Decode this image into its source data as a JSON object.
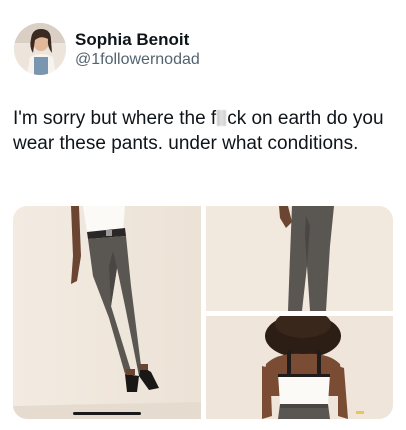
{
  "tweet": {
    "display_name": "Sophia Benoit",
    "handle": "@1followernodad",
    "text_part1": "I'm sorry but where the f",
    "text_part2": "ck on earth do you wear these pants. under what conditions."
  },
  "media": {
    "image_count": 3
  },
  "colors": {
    "text": "#0f1419",
    "secondary": "#536471",
    "photo_background": "#f0e6dc",
    "pants": "#5a5652"
  }
}
